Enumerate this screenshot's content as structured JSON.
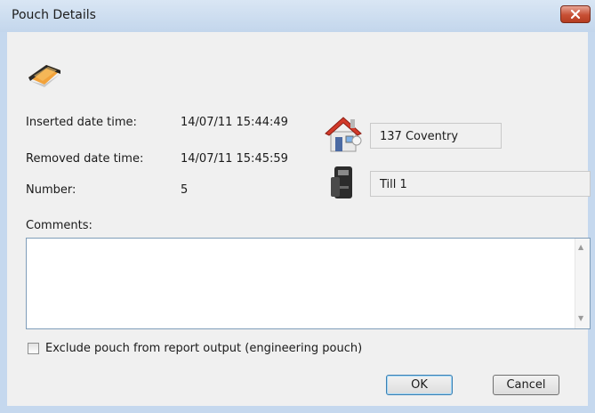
{
  "window": {
    "title": "Pouch Details",
    "close_label": "✕"
  },
  "details": {
    "inserted_label": "Inserted date time:",
    "inserted_value": "14/07/11 15:44:49",
    "removed_label": "Removed date time:",
    "removed_value": "14/07/11 15:45:59",
    "number_label": "Number:",
    "number_value": "5"
  },
  "site": {
    "value": "137 Coventry"
  },
  "till": {
    "value": "Till 1"
  },
  "comments": {
    "label": "Comments:",
    "value": ""
  },
  "exclude": {
    "label": "Exclude pouch from report output (engineering pouch)",
    "checked": false
  },
  "buttons": {
    "ok": "OK",
    "cancel": "Cancel"
  },
  "colors": {
    "title_bar": "#c5d8ee",
    "close_button": "#c74f34",
    "house_roof": "#d23a2a"
  },
  "icons": {
    "pouch": "pouch-icon",
    "site": "house-icon",
    "till": "till-icon"
  }
}
